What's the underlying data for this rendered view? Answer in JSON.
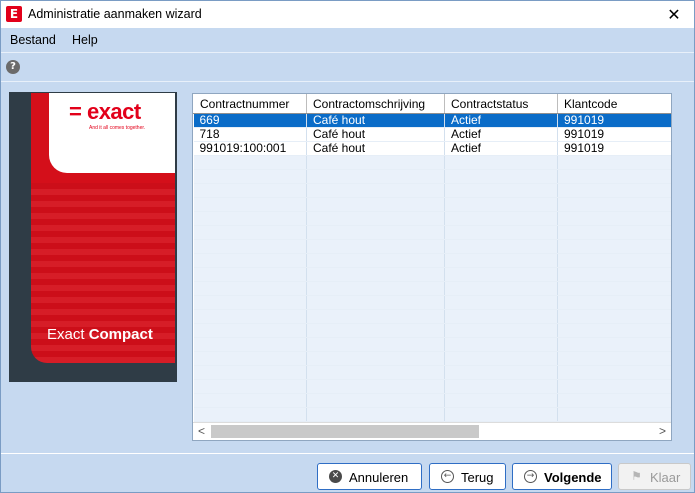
{
  "window": {
    "title": "Administratie aanmaken wizard",
    "close_glyph": "✕"
  },
  "menu": {
    "items": [
      {
        "label": "Bestand"
      },
      {
        "label": "Help"
      }
    ]
  },
  "toolbar": {
    "help_glyph": "?"
  },
  "banner": {
    "logo": "= exact",
    "tagline": "And it all comes together.",
    "product_light": "Exact ",
    "product_bold": "Compact"
  },
  "grid": {
    "columns": [
      "Contractnummer",
      "Contractomschrijving",
      "Contractstatus",
      "Klantcode"
    ],
    "rows": [
      {
        "cells": [
          "669",
          "Café hout",
          "Actief",
          "991019"
        ],
        "selected": true
      },
      {
        "cells": [
          "718",
          "Café hout",
          "Actief",
          "991019"
        ],
        "selected": false
      },
      {
        "cells": [
          "991019:100:001",
          "Café hout",
          "Actief",
          "991019"
        ],
        "selected": false
      }
    ],
    "scroll_left": "<",
    "scroll_right": ">"
  },
  "buttons": {
    "cancel": {
      "label": "Annuleren",
      "icon": "cancel-icon"
    },
    "back": {
      "label": "Terug",
      "icon": "back-arrow-icon"
    },
    "next": {
      "label": "Volgende",
      "icon": "next-arrow-icon"
    },
    "finish": {
      "label": "Klaar",
      "icon": "flag-icon"
    }
  },
  "colors": {
    "brand": "#e2001a",
    "selection": "#0a6cc8",
    "window_bg": "#c6d9f0"
  }
}
